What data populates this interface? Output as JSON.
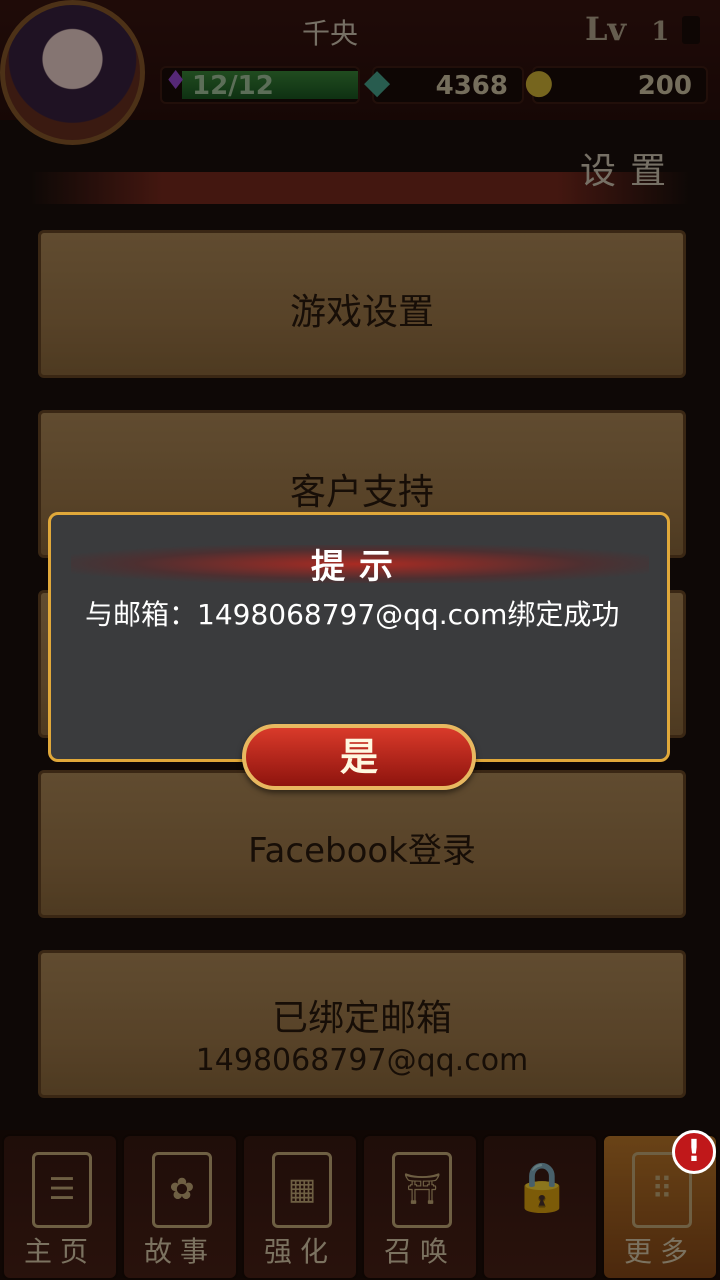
{
  "header": {
    "player_name": "千央",
    "level_label": "Lv",
    "level_value": "1",
    "stamina": "12/12",
    "stamina_level": 1.0,
    "gems": "4368",
    "gold": "200"
  },
  "section_title": "设置",
  "menu": {
    "game_settings": "游戏设置",
    "customer_support": "客户支持",
    "facebook_login": "Facebook登录",
    "bound_email_label": "已绑定邮箱",
    "bound_email_value": "1498068797@qq.com"
  },
  "dialog": {
    "title": "提示",
    "message": "与邮箱：1498068797@qq.com绑定成功",
    "confirm": "是"
  },
  "nav": {
    "items": [
      {
        "label": "主页",
        "icon": "scroll-icon"
      },
      {
        "label": "故事",
        "icon": "book-icon"
      },
      {
        "label": "强化",
        "icon": "grid-icon"
      },
      {
        "label": "召唤",
        "icon": "torii-icon"
      },
      {
        "label": "",
        "icon": "lock-icon"
      },
      {
        "label": "更多",
        "icon": "more-icon"
      }
    ],
    "badge": "!"
  },
  "colors": {
    "accent_gold": "#e0a83a",
    "confirm_red": "#c42a1e",
    "panel_tan": "#a07a4a"
  }
}
